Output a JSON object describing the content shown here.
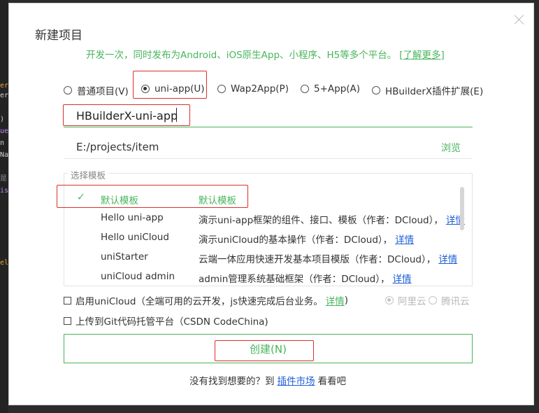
{
  "dialog": {
    "title": "新建项目",
    "subtitle": "开发一次，同时发布为Android、iOS原生App、小程序、H5等多个平台。",
    "learn_more": "[了解更多]"
  },
  "project_types": [
    {
      "label": "普通项目(V)",
      "checked": false
    },
    {
      "label": "uni-app(U)",
      "checked": true
    },
    {
      "label": "Wap2App(P)",
      "checked": false
    },
    {
      "label": "5+App(A)",
      "checked": false
    },
    {
      "label": "HBuilderX插件扩展(E)",
      "checked": false
    }
  ],
  "project_name": "HBuilderX-uni-app",
  "project_path": "E:/projects/item",
  "browse_label": "浏览",
  "templates": {
    "legend": "选择模板",
    "items": [
      {
        "name": "默认模板",
        "desc": "默认模板",
        "detail": "",
        "selected": true
      },
      {
        "name": "Hello uni-app",
        "desc": "演示uni-app框架的组件、接口、模板（作者：DCloud），",
        "detail": "详情",
        "selected": false
      },
      {
        "name": "Hello uniCloud",
        "desc": "演示uniCloud的基本操作（作者：DCloud），",
        "detail": "详情",
        "selected": false
      },
      {
        "name": "uniStarter",
        "desc": "云端一体应用快速开发基本项目模版（作者：DCloud），",
        "detail": "详情",
        "selected": false
      },
      {
        "name": "uniCloud admin",
        "desc": "admin管理系统基础框架（作者：DCloud），",
        "detail": "详情",
        "selected": false
      }
    ]
  },
  "unicloud": {
    "label": "启用uniCloud（全端可用的云开发，js快速完成后台业务。",
    "detail": "详情",
    "suffix": ")",
    "providers": [
      {
        "label": "阿里云",
        "checked": true
      },
      {
        "label": "腾讯云",
        "checked": false
      }
    ]
  },
  "git_upload": {
    "label": "上传到Git代码托管平台（CSDN CodeChina)"
  },
  "create_button": "创建(N)",
  "footer": {
    "prefix": "没有找到想要的？到",
    "market": "插件市场",
    "suffix": "看看吧"
  },
  "colors": {
    "accent": "#48b55c",
    "highlight": "#d9302c",
    "link": "#1e5fd8"
  },
  "background_code": [
    {
      "text": "er",
      "color": "#e8a33a"
    },
    {
      "text": "er",
      "color": "#cfcfcf"
    },
    {
      "text": ")",
      "color": "#cfcfcf"
    },
    {
      "text": "ue",
      "color": "#b58af0"
    },
    {
      "text": "n",
      "color": "#cfcfcf"
    },
    {
      "text": "Na",
      "color": "#cfcfcf"
    },
    {
      "text": "是",
      "color": "#8a8a8a"
    },
    {
      "text": "is",
      "color": "#b58af0"
    },
    {
      "text": "el",
      "color": "#e8a33a"
    }
  ]
}
